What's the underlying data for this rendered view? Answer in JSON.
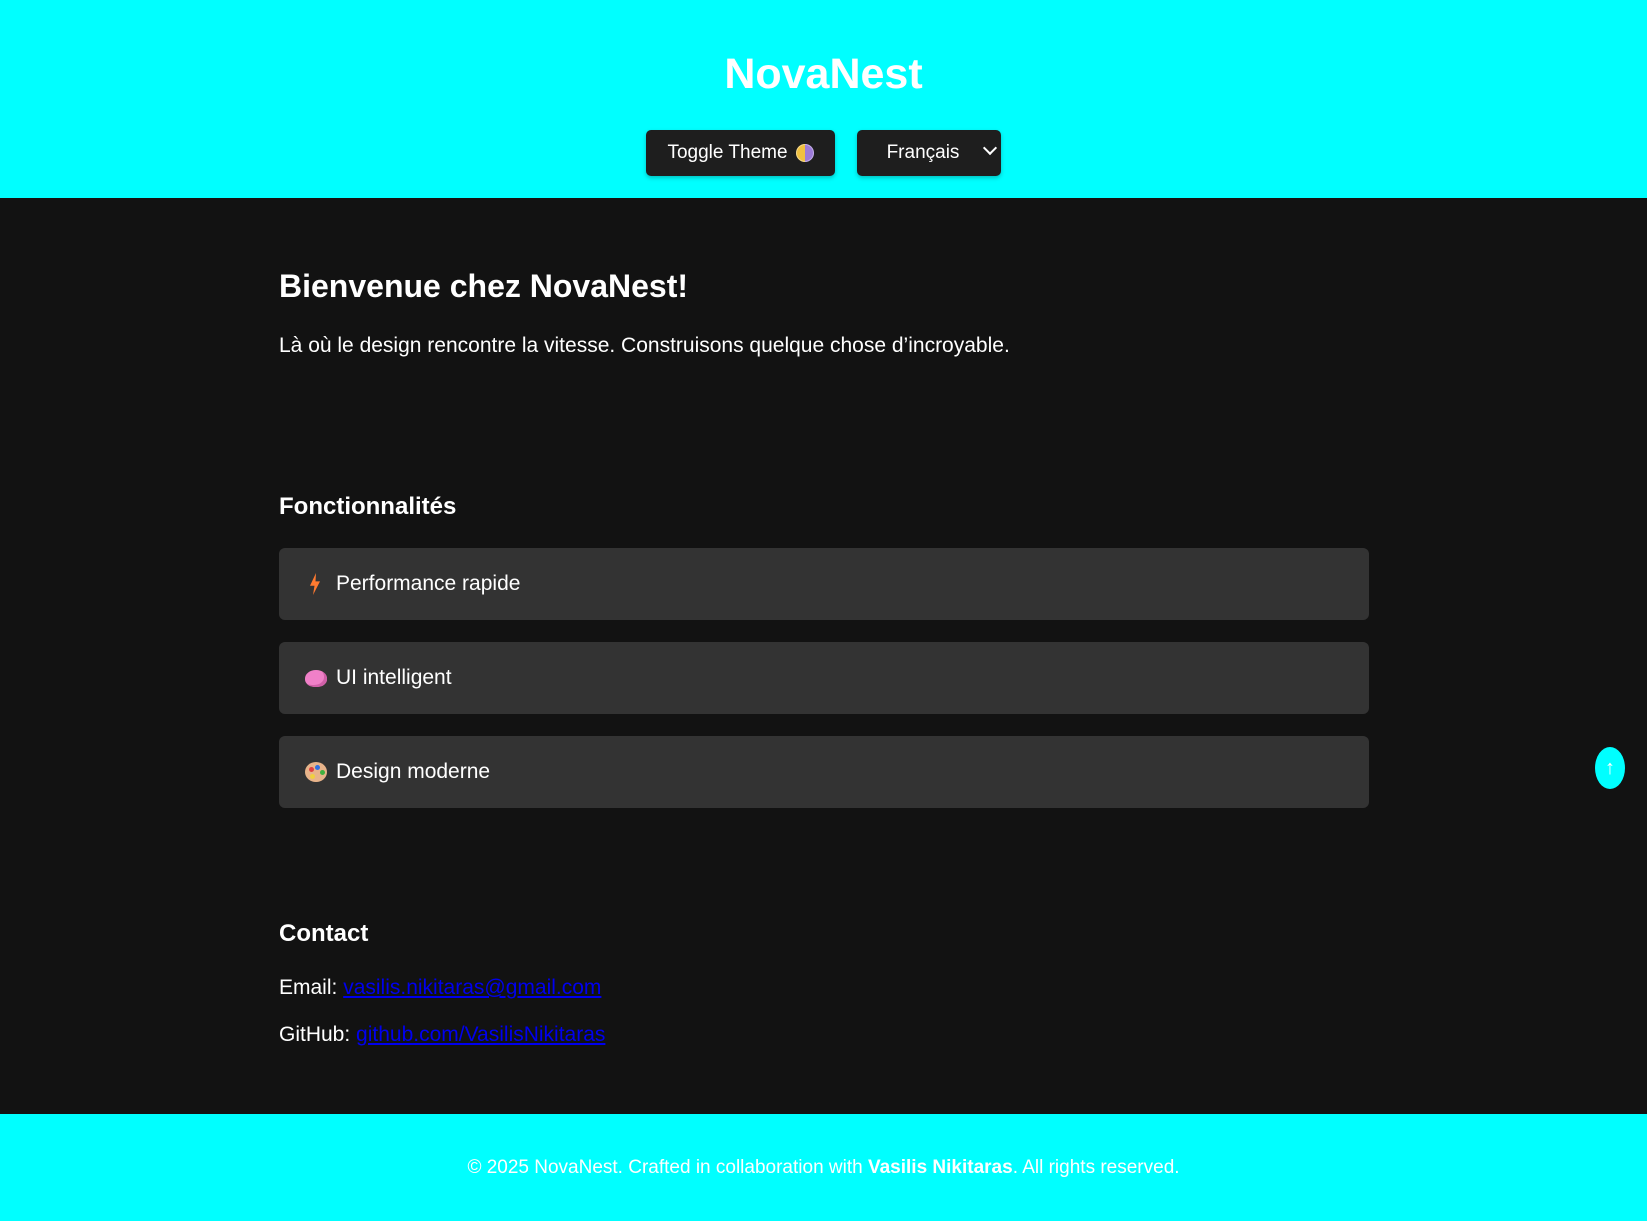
{
  "header": {
    "title": "NovaNest",
    "theme_button_label": "Toggle Theme",
    "language_selected": "Français"
  },
  "hero": {
    "title": "Bienvenue chez NovaNest!",
    "text": "Là où le design rencontre la vitesse. Construisons quelque chose d’incroyable."
  },
  "features": {
    "title": "Fonctionnalités",
    "items": [
      {
        "icon": "lightning-icon",
        "label": "Performance rapide"
      },
      {
        "icon": "brain-icon",
        "label": "UI intelligent"
      },
      {
        "icon": "palette-icon",
        "label": "Design moderne"
      }
    ]
  },
  "contact": {
    "title": "Contact",
    "email_label": "Email:",
    "email": "vasilis.nikitaras@gmail.com",
    "github_label": "GitHub:",
    "github": "github.com/VasilisNikitaras"
  },
  "scroll_top": {
    "glyph": "↑"
  },
  "footer": {
    "prefix": "© 2025 NovaNest. Crafted in collaboration with",
    "author": "Vasilis Nikitaras",
    "suffix": ". All rights reserved."
  },
  "colors": {
    "accent": "#00ffff",
    "background": "#121212",
    "card": "#333333",
    "link": "#0000ee"
  }
}
